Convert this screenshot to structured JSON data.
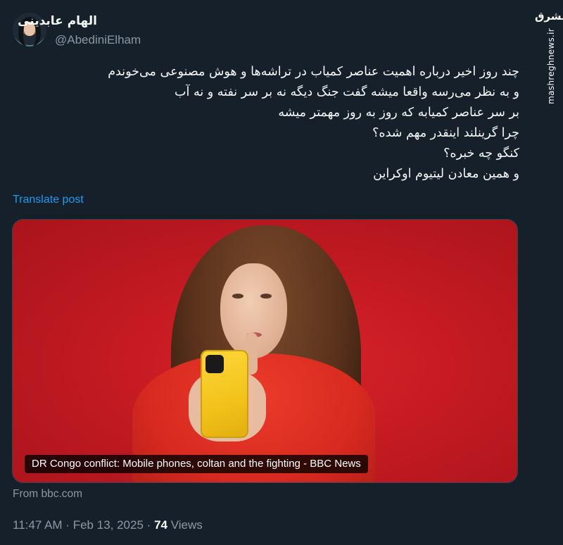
{
  "author": {
    "display_name": "الهام عابدینی",
    "handle": "@AbediniElham"
  },
  "tweet": {
    "lines": [
      "چند روز اخیر درباره اهمیت عناصر کمیاب در تراشه‌ها و هوش مصنوعی می‌خوندم",
      "و به نظر می‌رسه واقعا میشه گفت جنگ دیگه نه بر سر نفته و نه آب",
      "بر سر عناصر کمیابه که روز به روز مهمتر میشه",
      "چرا گرینلند اینقدر مهم شده؟",
      "کنگو چه خبره؟",
      "و همین معادن لیتیوم اوکراین"
    ],
    "translate_label": "Translate post"
  },
  "card": {
    "caption": "DR Congo conflict: Mobile phones, coltan and the fighting - BBC News",
    "source": "From bbc.com"
  },
  "meta": {
    "time": "11:47 AM",
    "date": "Feb 13, 2025",
    "separator": "·",
    "views_count": "74",
    "views_label": "Views"
  },
  "watermark": {
    "logo": "مشرق",
    "site": "mashreghnews.ir"
  },
  "icons": {
    "more": "more-icon"
  },
  "colors": {
    "background": "#15202b",
    "text_primary": "#f7f9f9",
    "text_secondary": "#8b98a5",
    "link": "#1d9bf0",
    "card_red": "#c41a22"
  }
}
